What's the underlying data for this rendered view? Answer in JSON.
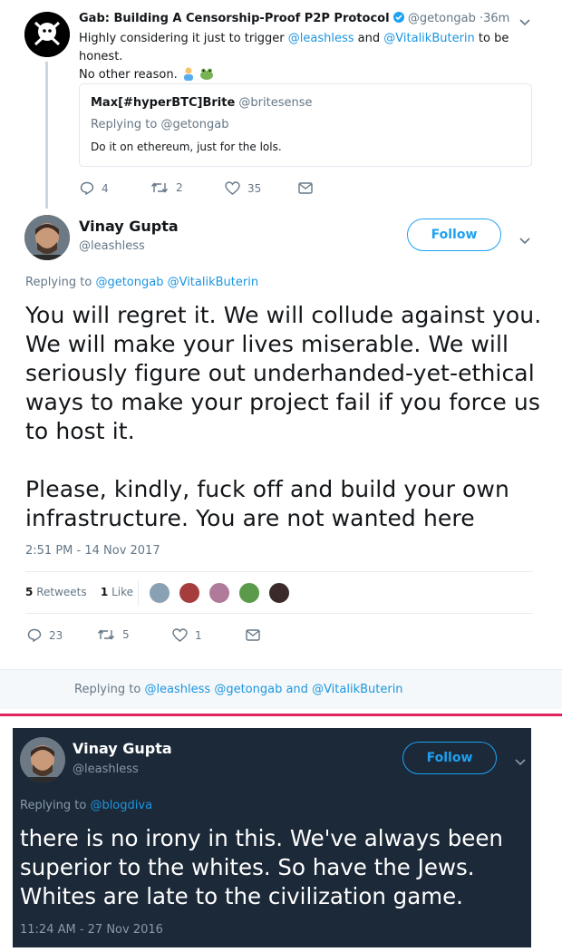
{
  "quote_tweet": {
    "author": "Gab: Building A Censorship-Proof P2P Protocol",
    "handle": "@getongab",
    "time": "·36m",
    "text_before": "Highly considering it just to trigger ",
    "mention1": "@leashless",
    "text_and": " and ",
    "mention2": "@VitalikButerin",
    "text_after": " to be honest.",
    "text_line2": "No other reason.",
    "quoted": {
      "author": "Max[#hyperBTC]Brite",
      "handle": "@britesense",
      "replying_label": "Replying to ",
      "replying_handle": "@getongab",
      "text": "Do it on ethereum, just for the lols."
    },
    "actions": {
      "replies": "4",
      "retweets": "2",
      "likes": "35"
    }
  },
  "main_tweet": {
    "author": "Vinay Gupta",
    "handle": "@leashless",
    "follow_label": "Follow",
    "replying_label": "Replying to ",
    "replying_handles": "@getongab @VitalikButerin",
    "text_p1": "You will regret it. We will collude against you. We will make your lives miserable. We will seriously figure out underhanded-yet-ethical ways to make your project fail if you force us to host it.",
    "text_p2": "Please, kindly, fuck off and build your own infrastructure. You are not wanted here",
    "timestamp": "2:51 PM - 14 Nov 2017",
    "retweets_count": "5",
    "retweets_label": "Retweets",
    "likes_count": "1",
    "likes_label": "Like",
    "actions": {
      "replies": "23",
      "retweets": "5",
      "likes": "1"
    },
    "reply_bar_label": "Replying to ",
    "reply_bar_handles": "@leashless @getongab",
    "reply_bar_and": " and ",
    "reply_bar_last": "@VitalikButerin"
  },
  "dark_tweet": {
    "author": "Vinay Gupta",
    "handle": "@leashless",
    "follow_label": "Follow",
    "replying_label": "Replying to ",
    "replying_handle": "@blogdiva",
    "text": "there is no irony in this. We've always been superior to the whites. So have the Jews. Whites are late to the civilization game.",
    "timestamp": "11:24 AM - 27 Nov 2016"
  },
  "colors": {
    "accent": "#1da1f2",
    "link": "#1b95e0",
    "divider_red": "#e0245e",
    "dark_bg": "#1c2938",
    "thread_line": "#ccd6dd"
  }
}
